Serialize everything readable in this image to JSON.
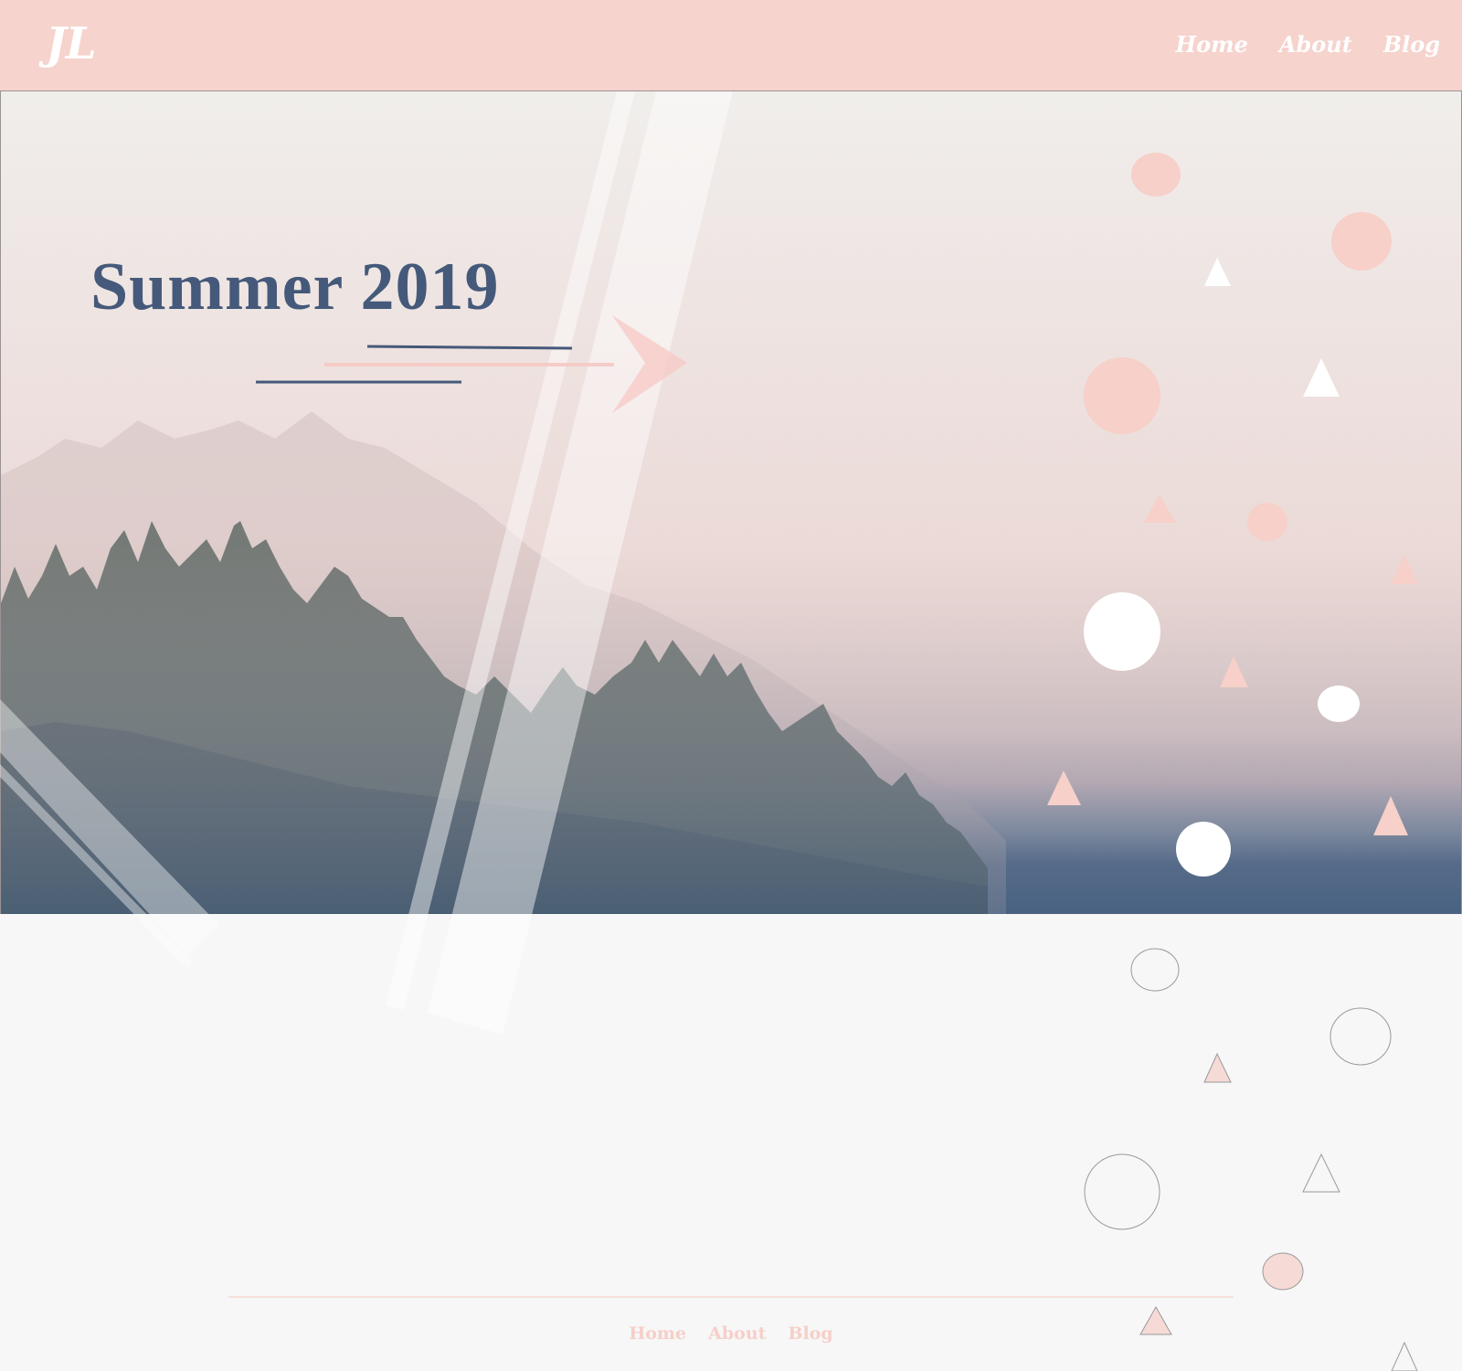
{
  "header": {
    "logo": "JL",
    "nav": [
      {
        "label": "Home"
      },
      {
        "label": "About"
      },
      {
        "label": "Blog"
      }
    ]
  },
  "hero": {
    "title": "Summer 2019"
  },
  "footer": {
    "nav": [
      {
        "label": "Home"
      },
      {
        "label": "About"
      },
      {
        "label": "Blog"
      }
    ]
  },
  "colors": {
    "header_bg": "#f6d3cd",
    "accent_pink": "#f5cbc4",
    "title_blue": "#45597a",
    "page_bg": "#f7f7f7"
  }
}
